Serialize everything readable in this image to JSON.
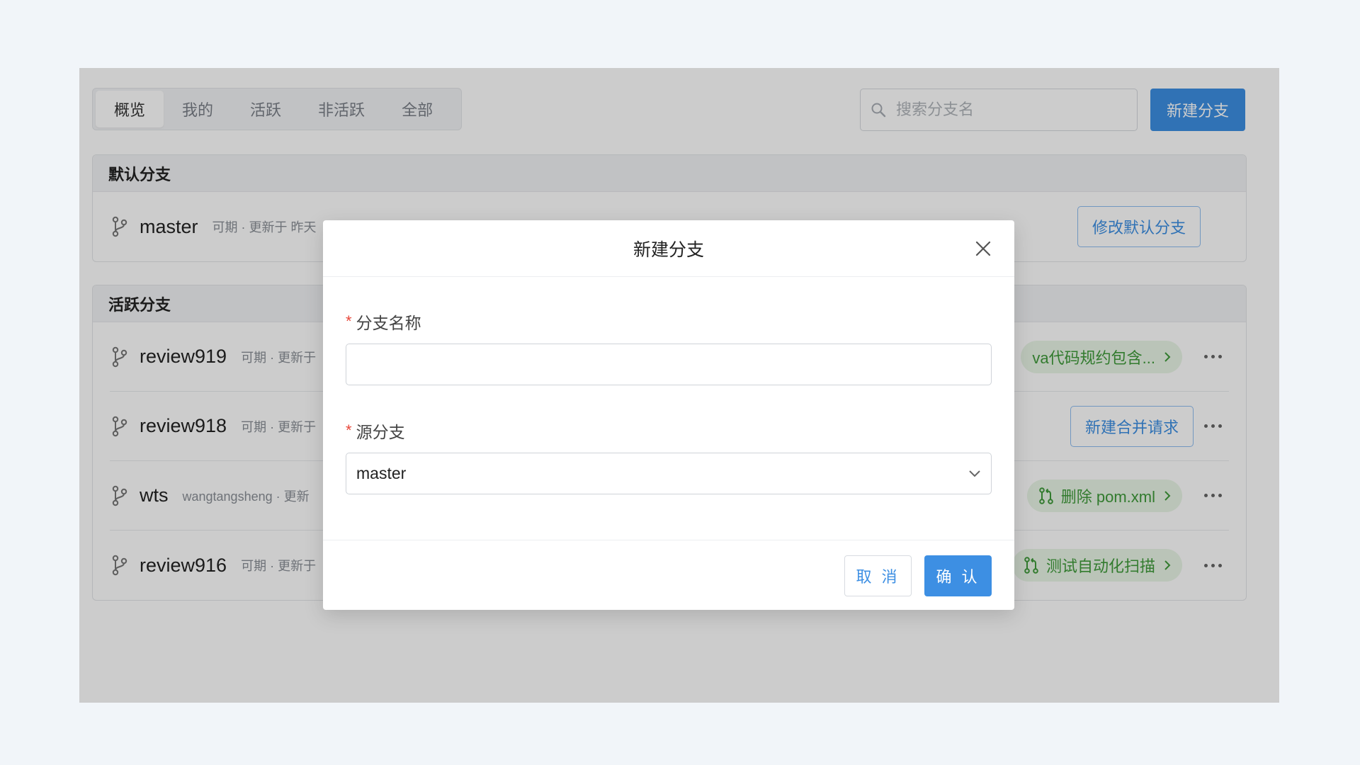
{
  "tabs": [
    {
      "label": "概览",
      "active": true
    },
    {
      "label": "我的",
      "active": false
    },
    {
      "label": "活跃",
      "active": false
    },
    {
      "label": "非活跃",
      "active": false
    },
    {
      "label": "全部",
      "active": false
    }
  ],
  "search": {
    "placeholder": "搜索分支名",
    "icon": "search-icon"
  },
  "header": {
    "new_branch_label": "新建分支"
  },
  "default_section": {
    "title": "默认分支",
    "branch": {
      "name": "master",
      "meta": "可期 · 更新于 昨天",
      "action_label": "修改默认分支"
    }
  },
  "active_section": {
    "title": "活跃分支",
    "branches": [
      {
        "name": "review919",
        "meta": "可期 · 更新于",
        "pr_label": "va代码规约包含..."
      },
      {
        "name": "review918",
        "meta": "可期 · 更新于",
        "action_label": "新建合并请求"
      },
      {
        "name": "wts",
        "meta": "wangtangsheng · 更新",
        "pr_label": "删除 pom.xml"
      },
      {
        "name": "review916",
        "meta": "可期 · 更新于",
        "pr_label": "测试自动化扫描"
      }
    ]
  },
  "modal": {
    "title": "新建分支",
    "name_field": {
      "required_mark": "*",
      "label": "分支名称",
      "value": ""
    },
    "source_field": {
      "required_mark": "*",
      "label": "源分支",
      "value": "master"
    },
    "cancel_label": "取 消",
    "confirm_label": "确 认"
  },
  "colors": {
    "primary": "#3d8fe3",
    "pr_green": "#3f9a3a",
    "pr_green_bg": "#e9f6e6",
    "required_red": "#e8483b"
  }
}
